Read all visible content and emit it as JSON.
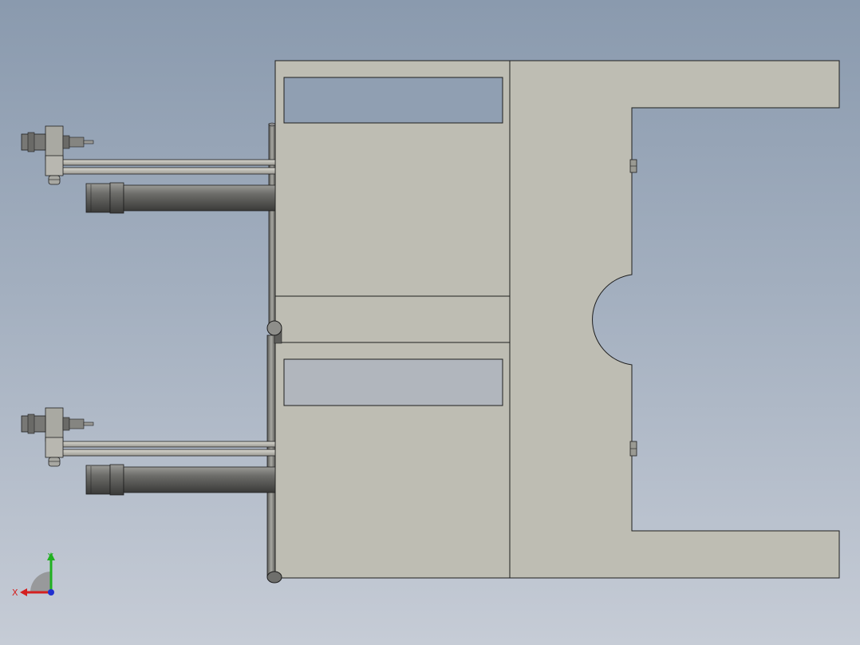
{
  "viewport": {
    "background_top": "#8a9aae",
    "background_bottom": "#c6ccd6",
    "part_fill": "#bebdb3",
    "edge_color": "#1e1e1e",
    "pocket_fill": "#909fb2",
    "cylinder_fill": "#6f6f6c"
  },
  "triad": {
    "x_label": "X",
    "y_label": "Y",
    "x_color": "#d42020",
    "y_color": "#20b020",
    "z_color": "#2030d0"
  }
}
